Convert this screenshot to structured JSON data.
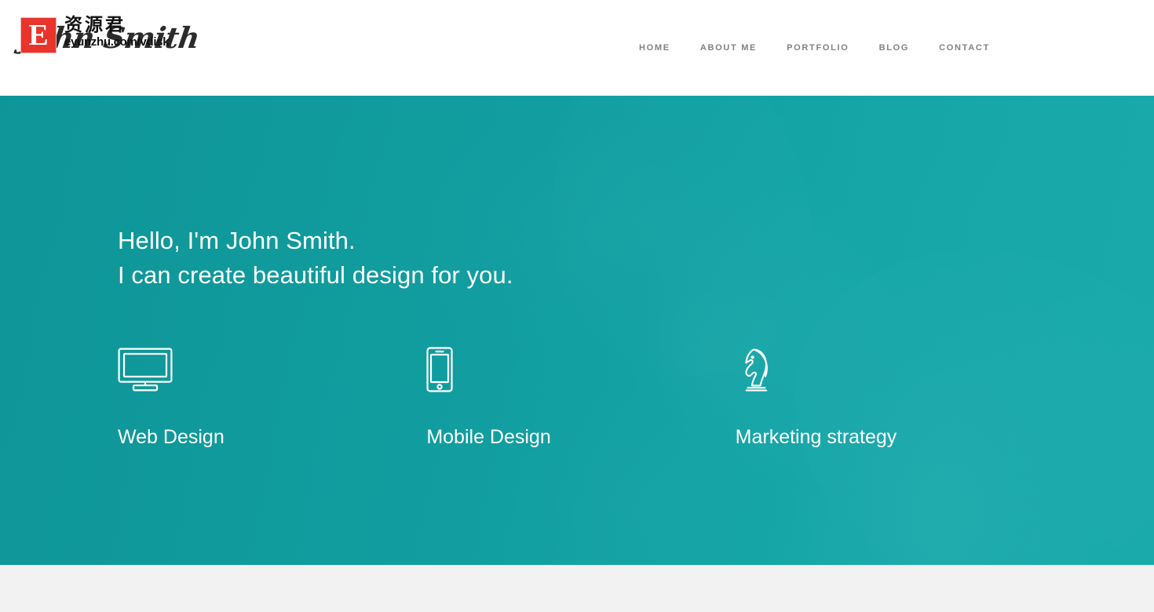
{
  "header": {
    "logo": {
      "script_text": "John Smith",
      "visible_fragment": "nith",
      "name": "john-smith-script-logo"
    },
    "watermark": {
      "badge_letter": "E",
      "badge_color": "#e8342a",
      "chinese_text": "资源君",
      "url": "eyunzhu.com/vdisk"
    },
    "background": "#ffffff",
    "nav": [
      {
        "label": "HOME",
        "name": "home"
      },
      {
        "label": "ABOUT ME",
        "name": "about-me"
      },
      {
        "label": "PORTFOLIO",
        "name": "portfolio"
      },
      {
        "label": "BLOG",
        "name": "blog"
      },
      {
        "label": "CONTACT",
        "name": "contact"
      }
    ]
  },
  "hero": {
    "overlay_color": "#13999b",
    "text_color": "#ffffff",
    "heading_lines": [
      "Hello, I'm John Smith.",
      "I can create beautiful design for you."
    ],
    "services": [
      {
        "icon": "desktop-monitor-icon",
        "label": "Web Design"
      },
      {
        "icon": "smartphone-icon",
        "label": "Mobile Design"
      },
      {
        "icon": "chess-knight-icon",
        "label": "Marketing strategy"
      }
    ]
  },
  "below_fold": {
    "background": "#f2f2f2"
  }
}
